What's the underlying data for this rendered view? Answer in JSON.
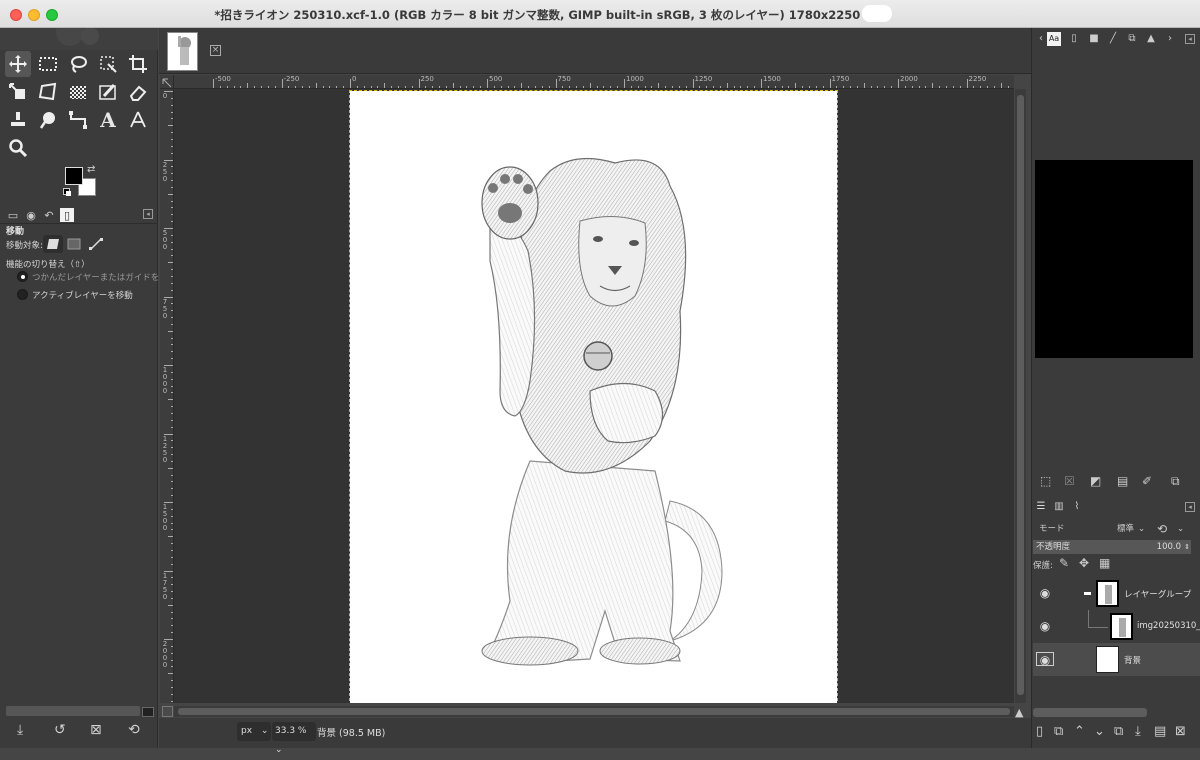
{
  "window": {
    "title": "*招きライオン 250310.xcf-1.0 (RGB カラー 8 bit ガンマ整数, GIMP built-in sRGB, 3 枚のレイヤー) 1780x2250 – "
  },
  "toolbox": {
    "tools": [
      "move-icon",
      "rect-select-icon",
      "lasso-icon",
      "fuzzy-select-icon",
      "crop-icon",
      "transform-icon",
      "perspective-icon",
      "gradient-icon",
      "paint-icon",
      "eraser-icon",
      "clone-icon",
      "smudge-icon",
      "paths-icon",
      "text-icon",
      "color-picker-icon",
      "zoom-icon"
    ],
    "options_title": "移動",
    "move_target_label": "移動対象:",
    "toggle_label": "機能の切り替え（⇧）",
    "radio_1": "つかんだレイヤーまたはガイドを",
    "radio_2": "アクティブレイヤーを移動"
  },
  "rulers": {
    "h_labels": [
      "-500",
      "-250",
      "0",
      "250",
      "500",
      "750",
      "1000",
      "1250",
      "1500",
      "1750",
      "2000",
      "2250"
    ],
    "v_labels": [
      "0",
      "250",
      "500",
      "750",
      "1000",
      "1250",
      "1500",
      "1750",
      "2000"
    ]
  },
  "statusbar": {
    "unit": "px",
    "zoom": "33.3 %",
    "status": "背景 (98.5 MB)"
  },
  "layers_panel": {
    "mode_label": "モード",
    "mode_value": "標準",
    "opacity_label": "不透明度",
    "opacity_value": "100.0",
    "lock_label": "保護:",
    "layers": [
      {
        "name": "レイヤーグループ",
        "visible": true
      },
      {
        "name": "img20250310_",
        "visible": true
      },
      {
        "name": "背景",
        "visible": true
      }
    ]
  },
  "colors": {
    "foreground": "#000000",
    "background": "#ffffff",
    "accent": "#d6c200"
  }
}
